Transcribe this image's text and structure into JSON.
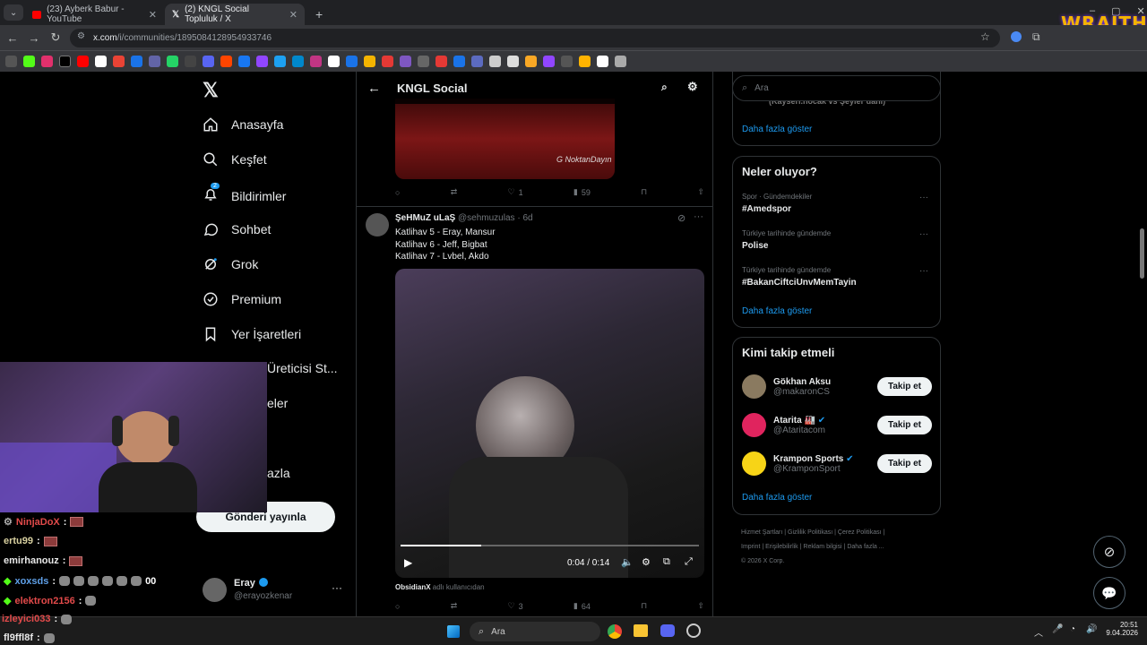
{
  "browser": {
    "tab1_title": "(23) Ayberk Babur - YouTube",
    "tab2_title": "(2) KNGL Social Topluluk / X",
    "url_host": "x.com",
    "url_path": "/i/communities/1895084128954933746",
    "overlay_logo": "WRAITH"
  },
  "nav": {
    "home": "Anasayfa",
    "explore": "Keşfet",
    "notifications": "Bildirimler",
    "notif_count": "2",
    "chat": "Sohbet",
    "grok": "Grok",
    "premium": "Premium",
    "bookmarks": "Yer İşaretleri",
    "creator": "Üreticisi St...",
    "lists": "eler",
    "more": "azla",
    "post_button": "Gönderi yayınla",
    "account_name": "Eray",
    "account_handle": "@erayozkenar"
  },
  "header": {
    "title": "KNGL Social"
  },
  "tweet1": {
    "watermark": "G NoktanDayın",
    "likes": "1",
    "views": "59"
  },
  "tweet2": {
    "name": "ŞeHMuZ uLaŞ",
    "handle": "@sehmuzulas",
    "time": "6d",
    "line1": "Katlihav 5 - Eray, Mansur",
    "line2": "Katlihav 6 - Jeff, Bigbat",
    "line3": "Katlihav 7 - Lvbel, Akdo",
    "video_time": "0:04 / 0:14",
    "via_user": "ObsidianX",
    "via_suffix": "adlı kullanıcıdan",
    "likes": "3",
    "views": "64"
  },
  "search": {
    "placeholder": "Ara"
  },
  "card1": {
    "cut_text": "(Kayseri.nocak vs Şeyler dahi)",
    "show_more": "Daha fazla göster"
  },
  "trends": {
    "title": "Neler oluyor?",
    "items": [
      {
        "context": "Spor · Gündemdekiler",
        "name": "#Amedspor"
      },
      {
        "context": "Türkiye tarihinde gündemde",
        "name": "Polise"
      },
      {
        "context": "Türkiye tarihinde gündemde",
        "name": "#BakanCiftciUnvMemTayin"
      }
    ],
    "show_more": "Daha fazla göster"
  },
  "who": {
    "title": "Kimi takip etmeli",
    "items": [
      {
        "name": "Gökhan Aksu",
        "handle": "@makaronCS",
        "button": "Takip et"
      },
      {
        "name": "Atarita 🏭",
        "handle": "@Ataritacom",
        "button": "Takip et"
      },
      {
        "name": "Krampon Sports",
        "handle": "@KramponSport",
        "button": "Takip et"
      }
    ],
    "show_more": "Daha fazla göster"
  },
  "footer": {
    "l1": "Hizmet Şartları",
    "l2": "Gizlilik Politikası",
    "l3": "Çerez Politikası",
    "l4": "Imprint",
    "l5": "Erişilebilirlik",
    "l6": "Reklam bilgisi",
    "l7": "Daha fazla ...",
    "copy": "© 2026 X Corp."
  },
  "chat": [
    {
      "user": "NinjaDoX",
      "color": "#e24a4a"
    },
    {
      "user": "ertu99",
      "color": "#d8d0a0"
    },
    {
      "user": "emirhanouz",
      "color": "#e8e8e8"
    },
    {
      "user": "xoxsds",
      "color": "#5fa0e8",
      "tail": "00"
    },
    {
      "user": "elektron2156",
      "color": "#e24a4a"
    },
    {
      "user": "izleyici033",
      "color": "#e24a4a"
    },
    {
      "user": "fl9ffl8f",
      "color": "#e8e8e8"
    }
  ],
  "taskbar": {
    "search": "Ara",
    "time": "20:51",
    "date": "9.04.2026"
  }
}
